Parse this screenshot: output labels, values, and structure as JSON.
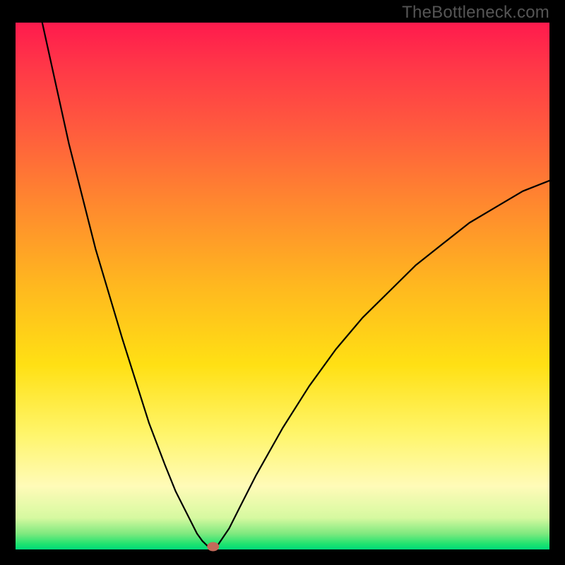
{
  "watermark": "TheBottleneck.com",
  "colors": {
    "frame": "#000000",
    "watermark_text": "#555555",
    "curve": "#000000",
    "min_marker": "#c46a5a",
    "gradient_stops": [
      "#ff1a4d",
      "#ff3648",
      "#ff5a3e",
      "#ff8a2e",
      "#ffb81f",
      "#ffe014",
      "#fff56a",
      "#fffbb8",
      "#d6f9a0",
      "#7fe97f",
      "#1de36f",
      "#00d97a"
    ]
  },
  "chart_data": {
    "type": "line",
    "title": "",
    "xlabel": "",
    "ylabel": "",
    "xlim": [
      0,
      100
    ],
    "ylim": [
      0,
      100
    ],
    "min_point": {
      "x": 37,
      "y": 0
    },
    "series": [
      {
        "name": "left-branch",
        "x": [
          5,
          10,
          15,
          20,
          25,
          28,
          30,
          32,
          34,
          35,
          36,
          37
        ],
        "values": [
          100,
          77,
          57,
          40,
          24,
          16,
          11,
          7,
          3,
          1.6,
          0.6,
          0
        ]
      },
      {
        "name": "right-branch",
        "x": [
          37,
          38,
          40,
          42,
          45,
          50,
          55,
          60,
          65,
          70,
          75,
          80,
          85,
          90,
          95,
          100
        ],
        "values": [
          0,
          1,
          4,
          8,
          14,
          23,
          31,
          38,
          44,
          49,
          54,
          58,
          62,
          65,
          68,
          70
        ]
      }
    ],
    "annotations": []
  }
}
